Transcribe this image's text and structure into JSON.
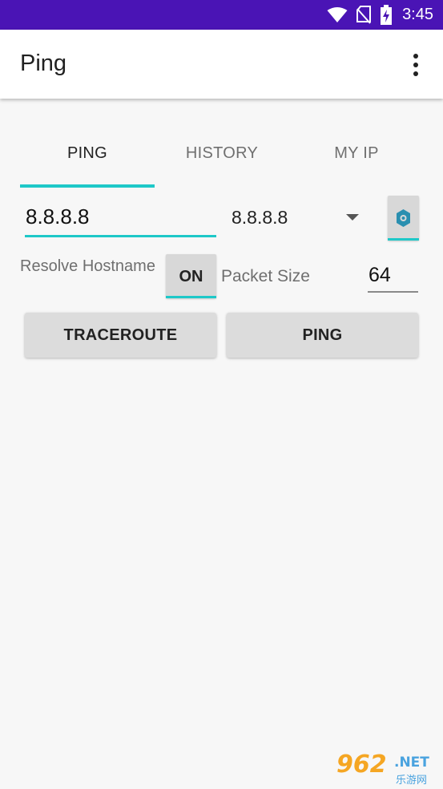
{
  "status_bar": {
    "time": "3:45",
    "icons": [
      "wifi-icon",
      "no-sim-icon",
      "battery-charging-icon"
    ],
    "color": "#4a14b5"
  },
  "app_bar": {
    "title": "Ping",
    "menu_icon": "more-vert-icon"
  },
  "tabs": [
    {
      "label": "PING",
      "active": true
    },
    {
      "label": "HISTORY",
      "active": false
    },
    {
      "label": "MY IP",
      "active": false
    }
  ],
  "host": {
    "input_value": "8.8.8.8",
    "select_value": "8.8.8.8",
    "settings_icon": "android-settings-icon"
  },
  "options": {
    "resolve_label": "Resolve Hostname",
    "resolve_toggle": "ON",
    "packet_size_label": "Packet Size",
    "packet_size_value": "64"
  },
  "actions": {
    "traceroute_label": "TRACEROUTE",
    "ping_label": "PING"
  },
  "watermark": {
    "number": "962",
    "domain": ".NET",
    "chinese": "乐游网"
  },
  "colors": {
    "accent": "#1ec8c8",
    "status_bar": "#4a14b5",
    "background": "#f7f7f7"
  }
}
